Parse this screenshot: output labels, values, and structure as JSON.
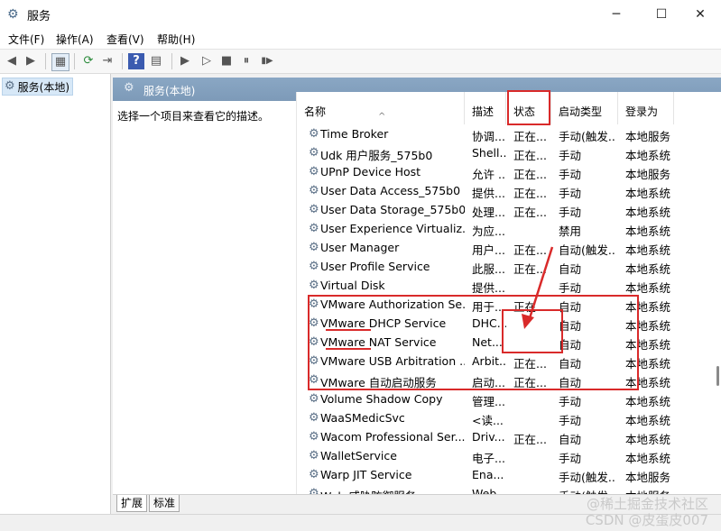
{
  "window": {
    "title": "服务",
    "minimize": "─",
    "maximize": "☐",
    "close": "✕"
  },
  "menu": [
    "文件(F)",
    "操作(A)",
    "查看(V)",
    "帮助(H)"
  ],
  "toolbar": {
    "back": "◀",
    "forward": "▶",
    "console_tree": "▦",
    "refresh": "⟳",
    "export": "⇥",
    "help": "?",
    "properties": "▤",
    "start": "▶",
    "start_params": "▷",
    "stop": "■",
    "pause": "⏸",
    "resume": "▮▶"
  },
  "tree": {
    "root_label": "服务(本地)"
  },
  "panel": {
    "title": "服务(本地)",
    "description_hint": "选择一个项目来查看它的描述。"
  },
  "columns": {
    "name": "名称",
    "desc": "描述",
    "status": "状态",
    "startup": "启动类型",
    "logon": "登录为"
  },
  "rows": [
    {
      "name": "Time Broker",
      "desc": "协调...",
      "status": "正在...",
      "startup": "手动(触发...",
      "logon": "本地服务"
    },
    {
      "name": "Udk 用户服务_575b0",
      "desc": "Shell...",
      "status": "正在...",
      "startup": "手动",
      "logon": "本地系统"
    },
    {
      "name": "UPnP Device Host",
      "desc": "允许 ...",
      "status": "正在...",
      "startup": "手动",
      "logon": "本地服务"
    },
    {
      "name": "User Data Access_575b0",
      "desc": "提供...",
      "status": "正在...",
      "startup": "手动",
      "logon": "本地系统"
    },
    {
      "name": "User Data Storage_575b0",
      "desc": "处理...",
      "status": "正在...",
      "startup": "手动",
      "logon": "本地系统"
    },
    {
      "name": "User Experience Virtualiz...",
      "desc": "为应...",
      "status": "",
      "startup": "禁用",
      "logon": "本地系统"
    },
    {
      "name": "User Manager",
      "desc": "用户...",
      "status": "正在...",
      "startup": "自动(触发...",
      "logon": "本地系统"
    },
    {
      "name": "User Profile Service",
      "desc": "此服...",
      "status": "正在...",
      "startup": "自动",
      "logon": "本地系统"
    },
    {
      "name": "Virtual Disk",
      "desc": "提供...",
      "status": "",
      "startup": "手动",
      "logon": "本地系统"
    },
    {
      "name": "VMware Authorization Se...",
      "desc": "用于...",
      "status": "正在...",
      "startup": "自动",
      "logon": "本地系统"
    },
    {
      "name": "VMware DHCP Service",
      "desc": "DHC...",
      "status": "",
      "startup": "自动",
      "logon": "本地系统"
    },
    {
      "name": "VMware NAT Service",
      "desc": "Net...",
      "status": "",
      "startup": "自动",
      "logon": "本地系统"
    },
    {
      "name": "VMware USB Arbitration ...",
      "desc": "Arbit...",
      "status": "正在...",
      "startup": "自动",
      "logon": "本地系统"
    },
    {
      "name": "VMware 自动启动服务",
      "desc": "启动...",
      "status": "正在...",
      "startup": "自动",
      "logon": "本地系统"
    },
    {
      "name": "Volume Shadow Copy",
      "desc": "管理...",
      "status": "",
      "startup": "手动",
      "logon": "本地系统"
    },
    {
      "name": "WaaSMedicSvc",
      "desc": "<读...",
      "status": "",
      "startup": "手动",
      "logon": "本地系统"
    },
    {
      "name": "Wacom Professional Ser...",
      "desc": "Driv...",
      "status": "正在...",
      "startup": "自动",
      "logon": "本地系统"
    },
    {
      "name": "WalletService",
      "desc": "电子...",
      "status": "",
      "startup": "手动",
      "logon": "本地系统"
    },
    {
      "name": "Warp JIT Service",
      "desc": "Ena...",
      "status": "",
      "startup": "手动(触发...",
      "logon": "本地服务"
    },
    {
      "name": "Web 威胁防御服务",
      "desc": "Web...",
      "status": "",
      "startup": "手动(触发...",
      "logon": "本地服务"
    }
  ],
  "tabs": [
    "扩展",
    "标准"
  ],
  "watermark": "@稀土掘金技术社区",
  "watermark2": "CSDN @皮蛋皮007",
  "colors": {
    "annotation": "#d92a2a",
    "header_bar": "#7f9cba",
    "selection": "#d7e8f7"
  }
}
